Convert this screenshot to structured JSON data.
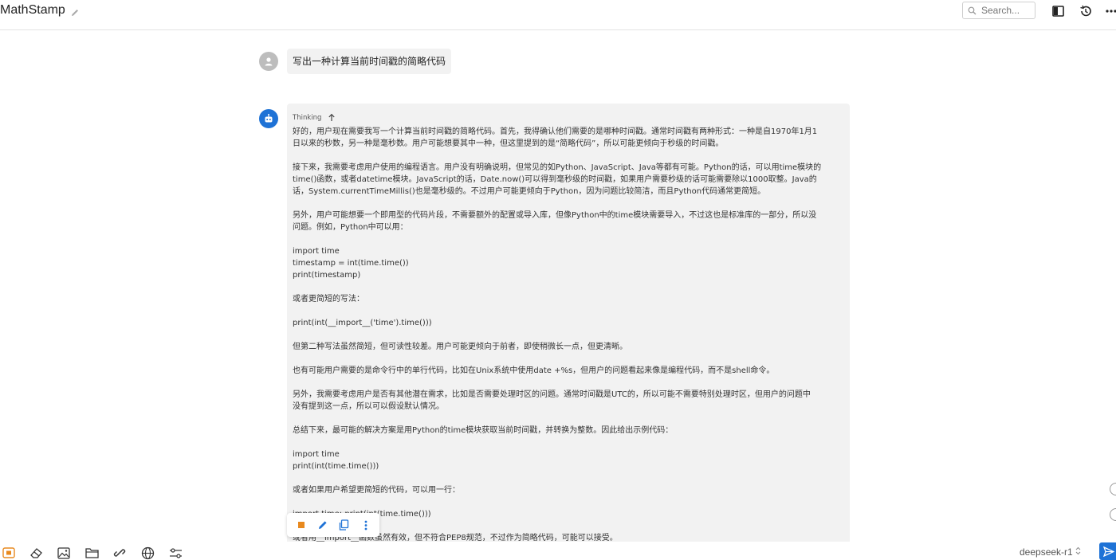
{
  "header": {
    "title": "MathStamp",
    "search_placeholder": "Search..."
  },
  "user_message": {
    "text": "写出一种计算当前时间戳的简略代码"
  },
  "assistant_message": {
    "thinking_label": "Thinking",
    "lines": [
      "好的，用户现在需要我写一个计算当前时间戳的简略代码。首先，我得确认他们需要的是哪种时间戳。通常时间戳有两种形式：一种是自1970年1月1",
      "日以来的秒数，另一种是毫秒数。用户可能想要其中一种，但这里提到的是“简略代码”，所以可能更倾向于秒级的时间戳。",
      "",
      "接下来，我需要考虑用户使用的编程语言。用户没有明确说明，但常见的如Python、JavaScript、Java等都有可能。Python的话，可以用time模块的",
      "time()函数，或者datetime模块。JavaScript的话，Date.now()可以得到毫秒级的时间戳，如果用户需要秒级的话可能需要除以1000取整。Java的",
      "话，System.currentTimeMillis()也是毫秒级的。不过用户可能更倾向于Python，因为问题比较简洁，而且Python代码通常更简短。",
      "",
      "另外，用户可能想要一个即用型的代码片段，不需要额外的配置或导入库，但像Python中的time模块需要导入，不过这也是标准库的一部分，所以没",
      "问题。例如，Python中可以用：",
      "",
      "import time",
      "timestamp = int(time.time())",
      "print(timestamp)",
      "",
      "或者更简短的写法：",
      "",
      "print(int(__import__('time').time()))",
      "",
      "但第二种写法虽然简短，但可读性较差。用户可能更倾向于前者，即使稍微长一点，但更清晰。",
      "",
      "也有可能用户需要的是命令行中的单行代码，比如在Unix系统中使用date +%s，但用户的问题看起来像是编程代码，而不是shell命令。",
      "",
      "另外，我需要考虑用户是否有其他潜在需求，比如是否需要处理时区的问题。通常时间戳是UTC的，所以可能不需要特别处理时区，但用户的问题中",
      "没有提到这一点，所以可以假设默认情况。",
      "",
      "总结下来，最可能的解决方案是用Python的time模块获取当前时间戳，并转换为整数。因此给出示例代码：",
      "",
      "import time",
      "print(int(time.time()))",
      "",
      "或者如果用户希望更简短的代码，可以用一行：",
      "",
      "import time; print(int(time.time()))",
      "",
      "或者用__import__函数虽然有效，但不符合PEP8规范，不过作为简略代码，可能可以接受。"
    ]
  },
  "bottom": {
    "model": "deepseek-r1"
  },
  "colors": {
    "accent": "#1e72d6",
    "stop": "#e8891e",
    "bubble_bg": "#f2f2f2"
  }
}
